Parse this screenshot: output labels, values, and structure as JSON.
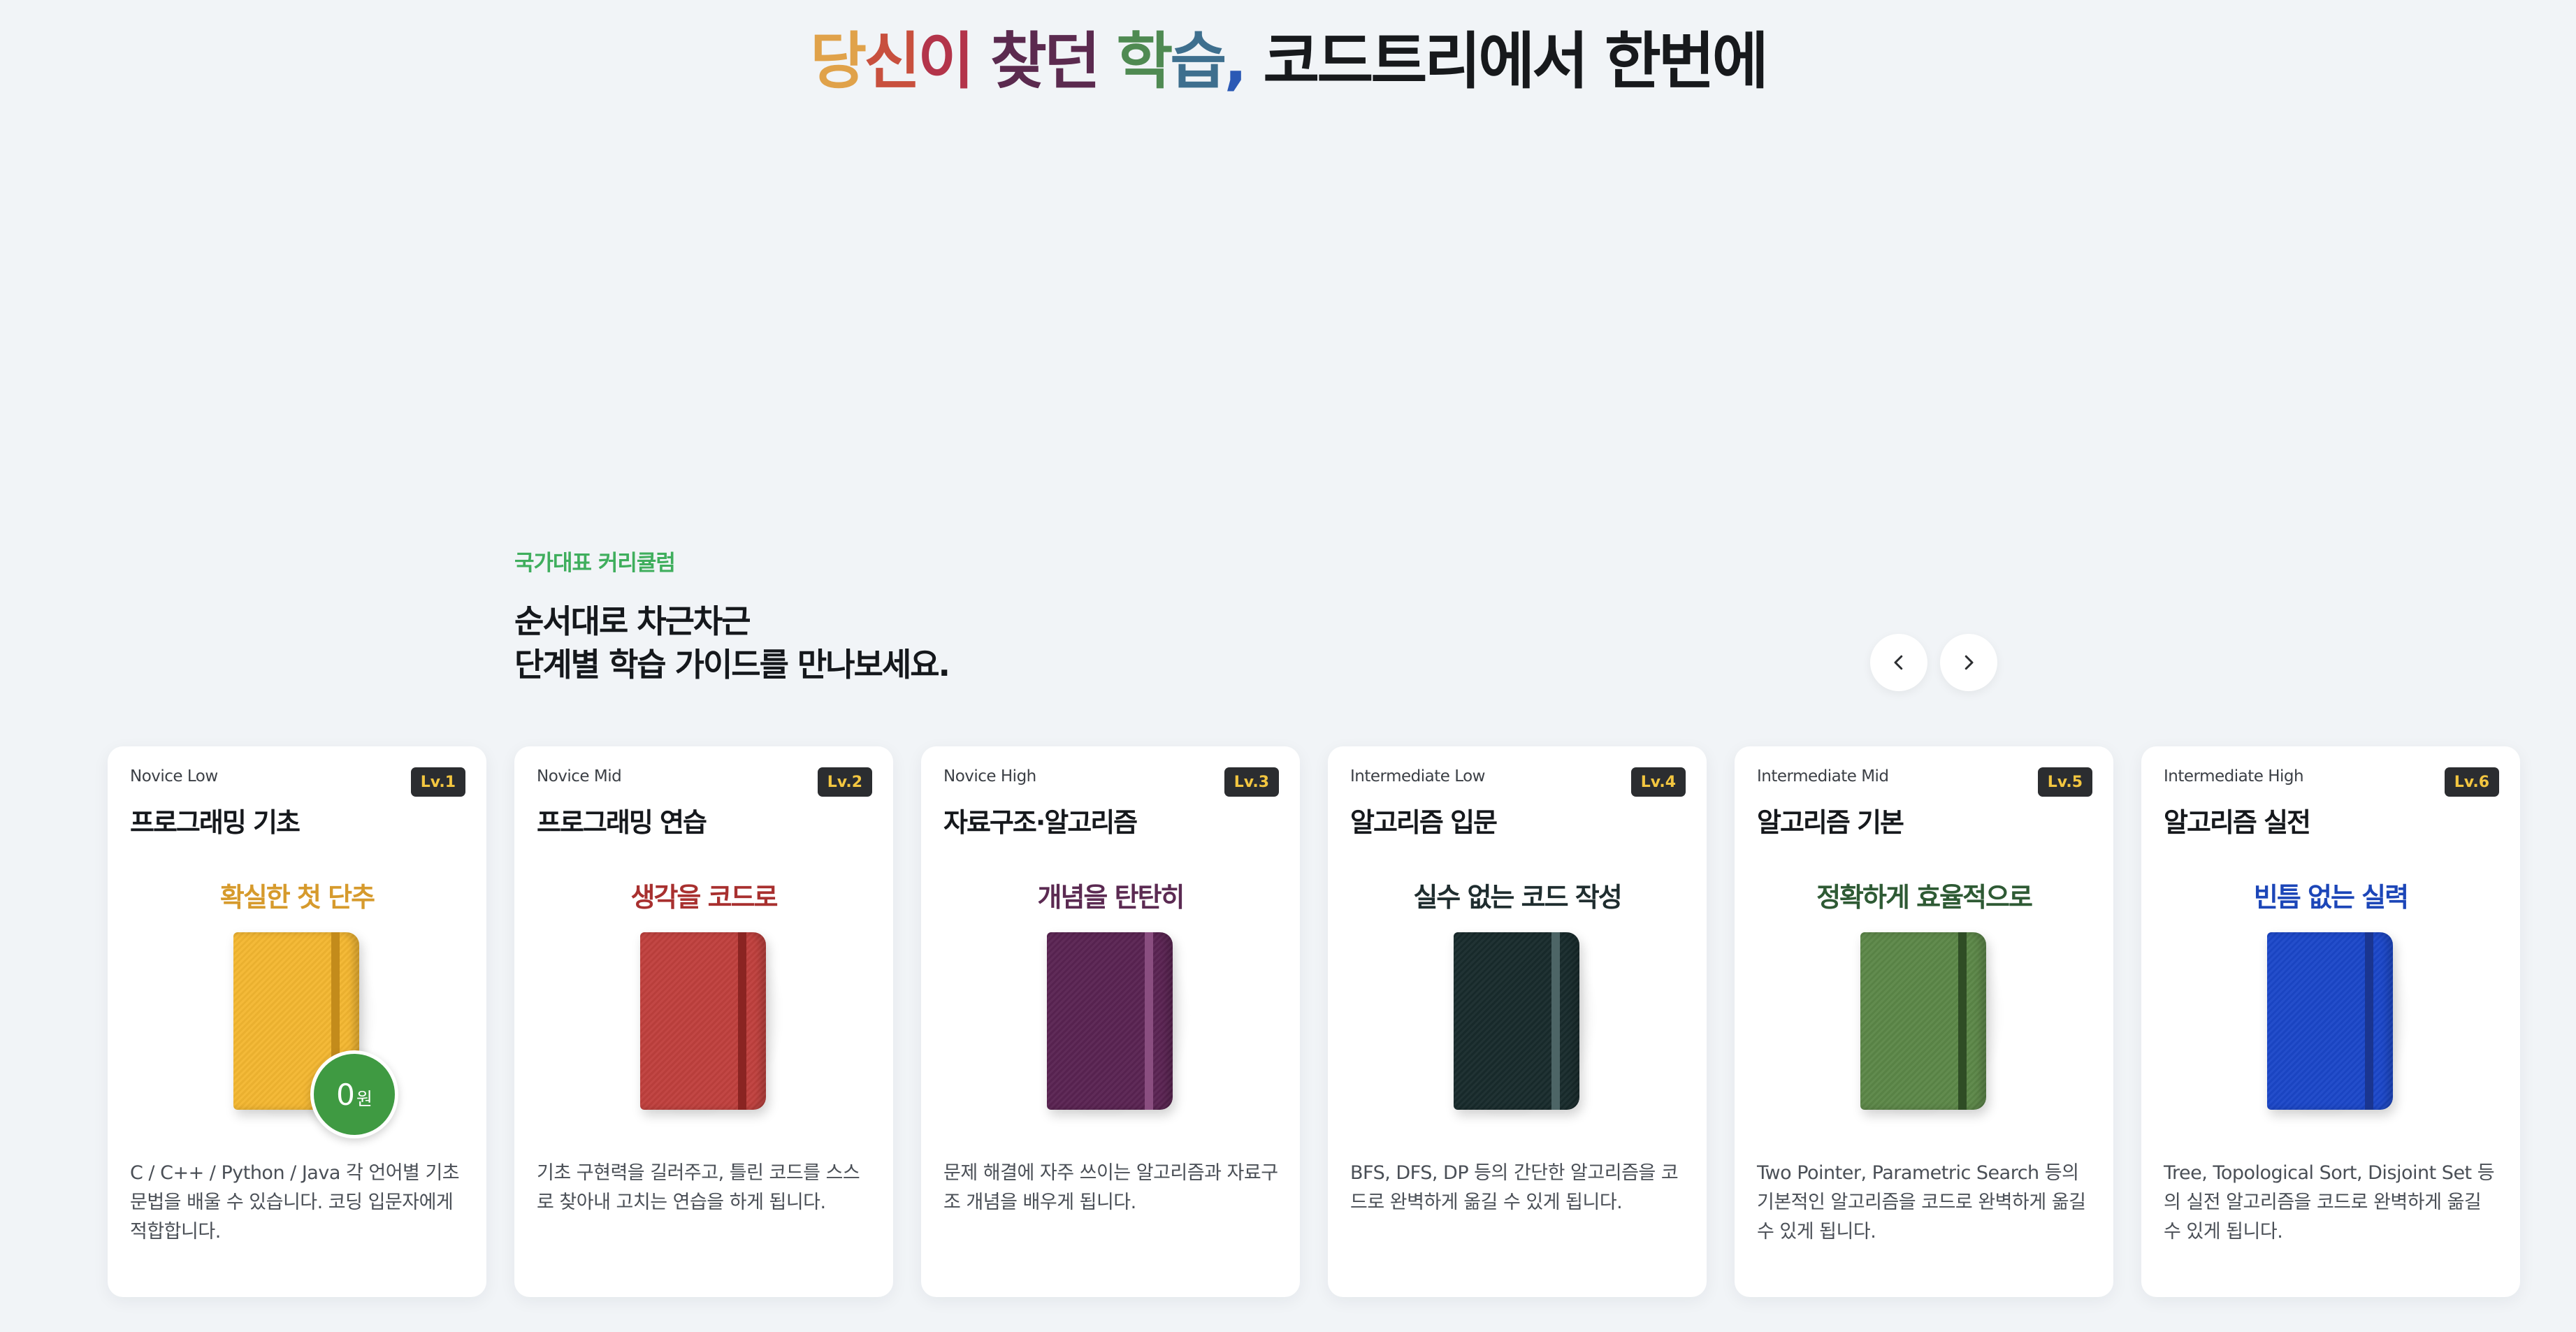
{
  "hero": {
    "parts": [
      {
        "text": "당",
        "color": "#e0a24a"
      },
      {
        "text": "신",
        "color": "#c8503e"
      },
      {
        "text": "이 ",
        "color": "#b3344a"
      },
      {
        "text": "찾던 ",
        "color": "#5b2a4f"
      },
      {
        "text": "학",
        "color": "#4f8a52"
      },
      {
        "text": "습",
        "color": "#3e6f8e"
      },
      {
        "text": ", ",
        "color": "#2b59b5"
      },
      {
        "text": "코드트리에서 한번에",
        "color": "#17191c"
      }
    ]
  },
  "section": {
    "eyebrow": "국가대표 커리큘럼",
    "headline_line1": "순서대로 차근차근",
    "headline_line2": "단계별 학습 가이드를 만나보세요."
  },
  "nav": {
    "prev_icon": "chevron-left-icon",
    "next_icon": "chevron-right-icon"
  },
  "cards": [
    {
      "level_name": "Novice Low",
      "badge": "Lv.1",
      "title": "프로그래밍 기초",
      "tagline": "확실한 첫 단추",
      "tagline_color": "#d69a2c",
      "book_color": "#f4b731",
      "strap_color": "#c38b1b",
      "price_num": "0",
      "price_unit": "원",
      "desc": "C / C++ / Python / Java 각 언어별 기초 문법을 배울 수 있습니다. 코딩 입문자에게 적합합니다."
    },
    {
      "level_name": "Novice Mid",
      "badge": "Lv.2",
      "title": "프로그래밍 연습",
      "tagline": "생각을 코드로",
      "tagline_color": "#a8302f",
      "book_color": "#c0403d",
      "strap_color": "#8a2422",
      "desc": "기초 구현력을 길러주고, 틀린 코드를 스스로 찾아내 고치는 연습을 하게 됩니다."
    },
    {
      "level_name": "Novice High",
      "badge": "Lv.3",
      "title": "자료구조·알고리즘",
      "tagline": "개념을 탄탄히",
      "tagline_color": "#5b2a52",
      "book_color": "#5a2352",
      "strap_color": "#8a4e80",
      "desc": "문제 해결에 자주 쓰이는 알고리즘과 자료구조 개념을 배우게 됩니다."
    },
    {
      "level_name": "Intermediate Low",
      "badge": "Lv.4",
      "title": "알고리즘 입문",
      "tagline": "실수 없는 코드 작성",
      "tagline_color": "#1f2d2f",
      "book_color": "#182b2c",
      "strap_color": "#4d6566",
      "desc": "BFS, DFS, DP 등의 간단한 알고리즘을 코드로 완벽하게 옮길 수 있게 됩니다."
    },
    {
      "level_name": "Intermediate Mid",
      "badge": "Lv.5",
      "title": "알고리즘 기본",
      "tagline": "정확하게 효율적으로",
      "tagline_color": "#2e5a34",
      "book_color": "#5c8748",
      "strap_color": "#2f4d25",
      "desc": "Two Pointer, Parametric Search 등의 기본적인 알고리즘을 코드로 완벽하게 옮길 수 있게 됩니다."
    },
    {
      "level_name": "Intermediate High",
      "badge": "Lv.6",
      "title": "알고리즘 실전",
      "tagline": "빈틈 없는 실력",
      "tagline_color": "#1c46b8",
      "book_color": "#1b47c9",
      "strap_color": "#1a3590",
      "desc": "Tree, Topological Sort, Disjoint Set 등의 실전 알고리즘을 코드로 완벽하게 옮길 수 있게 됩니다."
    }
  ]
}
